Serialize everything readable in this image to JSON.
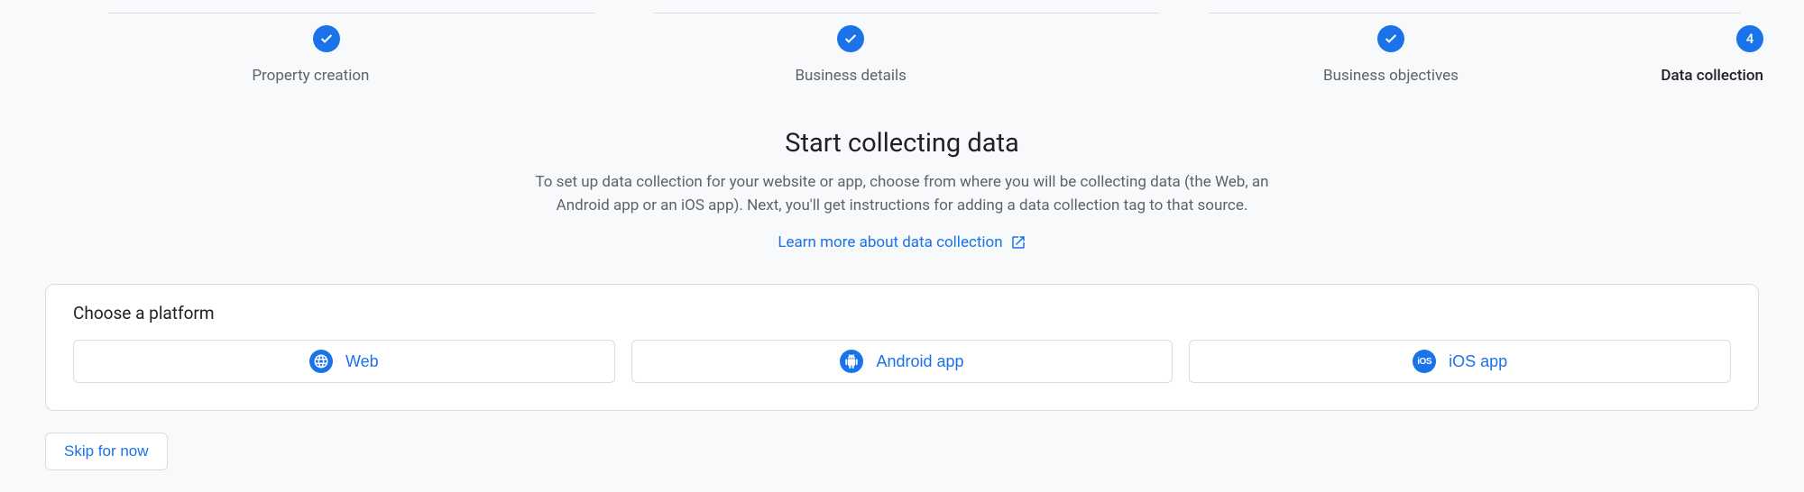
{
  "stepper": {
    "steps": [
      {
        "label": "Property creation",
        "state": "done"
      },
      {
        "label": "Business details",
        "state": "done"
      },
      {
        "label": "Business objectives",
        "state": "done"
      },
      {
        "label": "Data collection",
        "state": "active",
        "number": "4"
      }
    ]
  },
  "content": {
    "title": "Start collecting data",
    "description": "To set up data collection for your website or app, choose from where you will be collecting data (the Web, an Android app or an iOS app). Next, you'll get instructions for adding a data collection tag to that source.",
    "learn_more_label": "Learn more about data collection"
  },
  "card": {
    "title": "Choose a platform",
    "platforms": {
      "web_label": "Web",
      "android_label": "Android app",
      "ios_label": "iOS app"
    }
  },
  "footer": {
    "skip_label": "Skip for now"
  },
  "colors": {
    "primary": "#1a73e8",
    "text_secondary": "#5f6368",
    "border": "#dadce0",
    "background": "#f8f9fa"
  }
}
